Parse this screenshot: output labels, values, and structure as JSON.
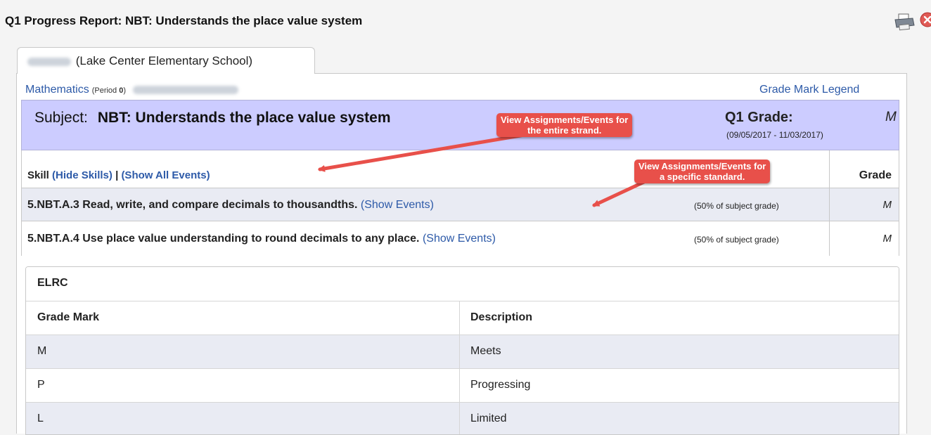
{
  "window": {
    "title": "Q1 Progress Report: NBT: Understands the place value system",
    "print_icon": "printer-icon",
    "close_icon": "close-circle-icon"
  },
  "tab": {
    "label": "(Lake Center Elementary School)"
  },
  "course": {
    "name": "Mathematics",
    "period_label": "(Period ",
    "period_number": "0",
    "period_close": ")",
    "grade_mark_legend_link": "Grade Mark Legend"
  },
  "subject": {
    "label": "Subject:",
    "name": "NBT: Understands the place value system",
    "grade_label": "Q1 Grade:",
    "grade_value": "M",
    "date_range": "(09/05/2017 - 11/03/2017)"
  },
  "skills": {
    "header_label": "Skill",
    "hide_skills_link": "(Hide Skills)",
    "separator": "|",
    "show_all_events_link": "(Show All Events)",
    "grade_header": "Grade",
    "rows": [
      {
        "standard": "5.NBT.A.3 Read, write, and compare decimals to thousandths.",
        "show_events_link": "(Show Events)",
        "weight": "(50% of subject grade)",
        "grade": "M"
      },
      {
        "standard": "5.NBT.A.4 Use place value understanding to round decimals to any place.",
        "show_events_link": "(Show Events)",
        "weight": "(50% of subject grade)",
        "grade": "M"
      }
    ]
  },
  "annotations": {
    "callout_strand_line1": "View Assignments/Events for",
    "callout_strand_line2": "the entire strand.",
    "callout_standard_line1": "View Assignments/Events for",
    "callout_standard_line2": "a specific standard.",
    "color": "#e8504a"
  },
  "legend_table": {
    "title": "ELRC",
    "col_mark": "Grade Mark",
    "col_description": "Description",
    "rows": [
      {
        "mark": "M",
        "description": "Meets"
      },
      {
        "mark": "P",
        "description": "Progressing"
      },
      {
        "mark": "L",
        "description": "Limited"
      }
    ]
  },
  "colors": {
    "subject_band": "#ccccff",
    "link": "#2d5aa8",
    "row_alt": "#e9ebf3"
  }
}
